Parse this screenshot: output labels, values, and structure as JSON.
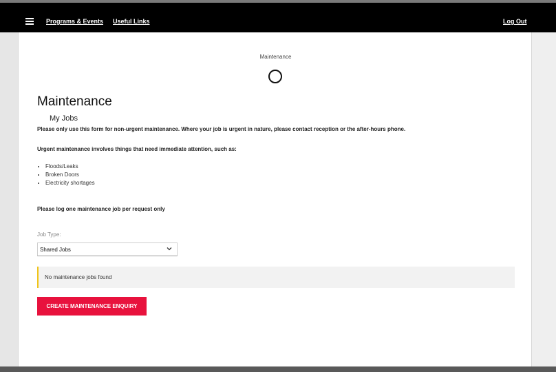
{
  "navbar": {
    "menu_icon": "hamburger-menu-icon",
    "programs_label": "Programs & Events",
    "links_label": "Useful Links",
    "logout_label": "Log Out"
  },
  "breadcrumb": "Maintenance",
  "loading_icon": "loading-spinner-icon",
  "page": {
    "title": "Maintenance",
    "subtitle": "My Jobs",
    "notice": "Please only use this form for non-urgent maintenance. Where your job is urgent in nature, please contact reception or the after-hours phone.",
    "urgent_intro": "Urgent maintenance involves things that need immediate attention, such as:",
    "urgent_items": [
      "Floods/Leaks",
      "Broken Doors",
      "Electricity shortages"
    ],
    "one_job": "Please log one maintenance job per request only"
  },
  "job_type": {
    "label": "Job Type:",
    "selected": "Shared Jobs",
    "chevron_icon": "chevron-down-icon"
  },
  "empty_state": "No maintenance jobs found",
  "create_button": "CREATE MAINTENANCE ENQUIRY",
  "colors": {
    "navbar": "#000000",
    "accent": "#e8123d",
    "warning_border": "#f0c419"
  }
}
